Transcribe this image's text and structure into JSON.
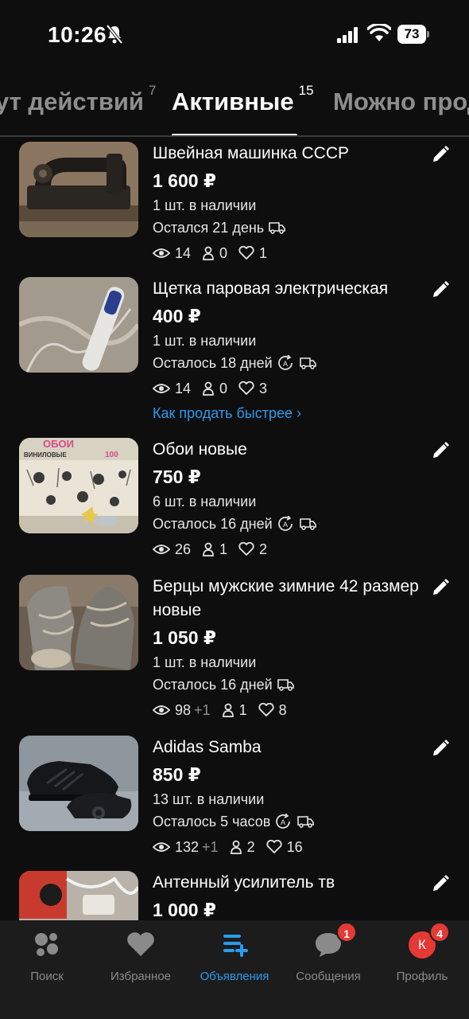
{
  "status": {
    "time": "10:26",
    "battery": "73"
  },
  "tabs": [
    {
      "label": "ут действий",
      "count": "7"
    },
    {
      "label": "Активные",
      "count": "15"
    },
    {
      "label": "Можно прод",
      "count": ""
    }
  ],
  "listings": [
    {
      "title": "Швейная машинка СССР",
      "price": "1 600 ₽",
      "stock": "1 шт. в наличии",
      "remain": "Остался 21 день",
      "views": "14",
      "views_delta": "",
      "contacts": "0",
      "favorites": "1"
    },
    {
      "title": "Щетка паровая электрическая",
      "price": "400 ₽",
      "stock": "1 шт. в наличии",
      "remain": "Осталось 18 дней",
      "views": "14",
      "views_delta": "",
      "contacts": "0",
      "favorites": "3",
      "link": "Как продать быстрее"
    },
    {
      "title": "Обои новые",
      "price": "750 ₽",
      "stock": "6 шт. в наличии",
      "remain": "Осталось 16 дней",
      "views": "26",
      "views_delta": "",
      "contacts": "1",
      "favorites": "2",
      "thumb_text_1": "ОБОИ",
      "thumb_text_2": "ВИНИЛОВЫЕ",
      "thumb_text_3": "100"
    },
    {
      "title": "Берцы мужские зимние 42 размер новые",
      "price": "1 050 ₽",
      "stock": "1 шт. в наличии",
      "remain": "Осталось 16 дней",
      "views": "98",
      "views_delta": "+1",
      "contacts": "1",
      "favorites": "8"
    },
    {
      "title": "Adidas Samba",
      "price": "850 ₽",
      "stock": "13 шт. в наличии",
      "remain": "Осталось 5 часов",
      "views": "132",
      "views_delta": "+1",
      "contacts": "2",
      "favorites": "16"
    },
    {
      "title": "Антенный усилитель тв",
      "price": "1 000 ₽"
    }
  ],
  "nav": [
    {
      "label": "Поиск"
    },
    {
      "label": "Избранное"
    },
    {
      "label": "Объявления"
    },
    {
      "label": "Сообщения",
      "badge": "1"
    },
    {
      "label": "Профиль",
      "badge": "4",
      "avatar": "К"
    }
  ],
  "colors": {
    "accent": "#2a9bf0",
    "badge": "#e53935",
    "background": "#0e0e0e",
    "nav_bg": "#1c1c1c",
    "muted": "#8e8e8e"
  }
}
